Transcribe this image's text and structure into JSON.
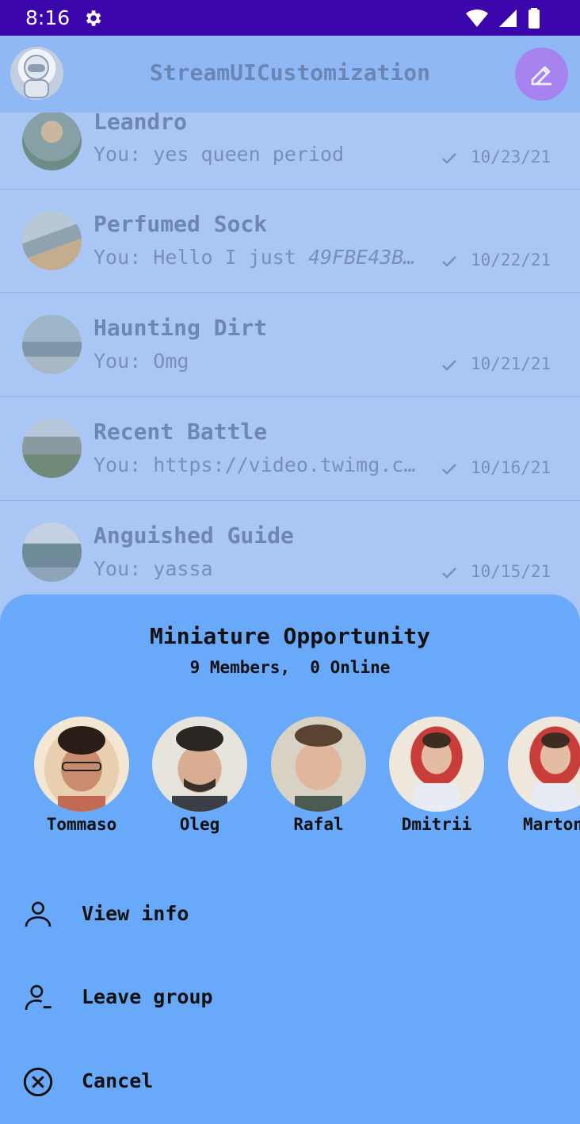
{
  "status_bar": {
    "time": "8:16",
    "icons": [
      "gear-icon",
      "wifi-icon",
      "signal-icon",
      "battery-icon"
    ]
  },
  "app_bar": {
    "title": "StreamUICustomization",
    "avatar_icon": "user-avatar",
    "compose_icon": "pencil-icon",
    "compose_color": "#a783f0",
    "background": "#90b8f4"
  },
  "channels": [
    {
      "name": "Leandro",
      "prefix": "You: ",
      "message": "yes queen period",
      "message_italic": "",
      "date": "10/23/21",
      "read_icon": "check-icon"
    },
    {
      "name": "Perfumed Sock",
      "prefix": "You: ",
      "message": "Hello I just ",
      "message_italic": "49FBE43B…",
      "date": "10/22/21",
      "read_icon": "check-icon"
    },
    {
      "name": "Haunting Dirt",
      "prefix": "You: ",
      "message": "Omg",
      "message_italic": "",
      "date": "10/21/21",
      "read_icon": "check-icon"
    },
    {
      "name": "Recent Battle",
      "prefix": "You: ",
      "message": "https://video.twimg.c…",
      "message_italic": "",
      "date": "10/16/21",
      "read_icon": "check-icon"
    },
    {
      "name": "Anguished Guide",
      "prefix": "You: ",
      "message": "yassa",
      "message_italic": "",
      "date": "10/15/21",
      "read_icon": "check-icon"
    }
  ],
  "sheet": {
    "title": "Miniature Opportunity",
    "subtitle": "9 Members,  0 Online",
    "background": "#69a9fa",
    "members": [
      {
        "name": "Tommaso"
      },
      {
        "name": "Oleg"
      },
      {
        "name": "Rafal"
      },
      {
        "name": "Dmitrii"
      },
      {
        "name": "Marton"
      }
    ],
    "actions": [
      {
        "label": "View info",
        "icon": "person-icon"
      },
      {
        "label": "Leave group",
        "icon": "person-remove-icon"
      },
      {
        "label": "Cancel",
        "icon": "cancel-circle-icon"
      }
    ]
  }
}
